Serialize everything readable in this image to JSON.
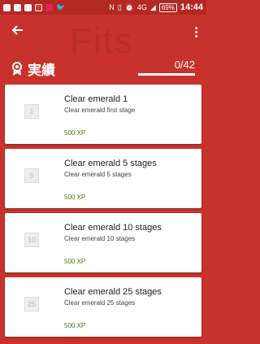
{
  "status_bar": {
    "time": "14:44",
    "battery": "69%",
    "network": "4G"
  },
  "header": {
    "bg_logo": "Fits",
    "title": "実績",
    "progress_text": "0/42",
    "progress_fraction": 0
  },
  "achievements": [
    {
      "badge": "1",
      "title": "Clear emerald 1",
      "desc": "Clear emerald first stage",
      "xp": "500 XP"
    },
    {
      "badge": "5",
      "title": "Clear emerald 5 stages",
      "desc": "Clear emerald 5 stages",
      "xp": "500 XP"
    },
    {
      "badge": "10",
      "title": "Clear emerald 10 stages",
      "desc": "Clear emerald 10 stages",
      "xp": "500 XP"
    },
    {
      "badge": "25",
      "title": "Clear emerald 25 stages",
      "desc": "Clear emerald 25 stages",
      "xp": "500 XP"
    }
  ]
}
